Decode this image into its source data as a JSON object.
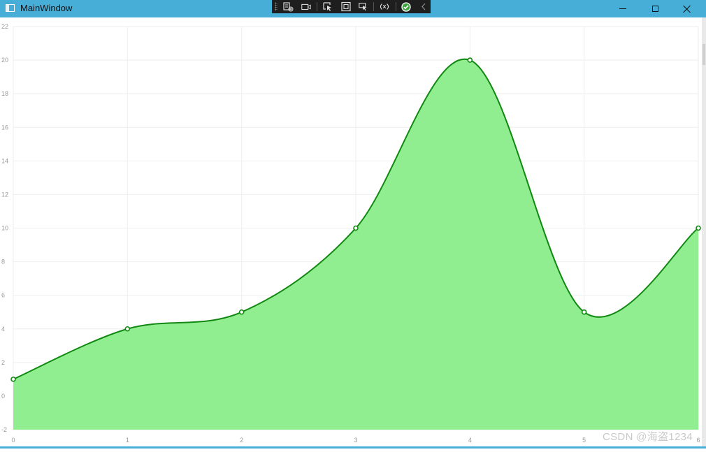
{
  "window": {
    "title": "MainWindow",
    "controls": {
      "minimize": "minimize-icon",
      "maximize": "maximize-icon",
      "close": "close-icon"
    },
    "accent_color": "#47aed8"
  },
  "debug_toolbar": {
    "icons": [
      "visual-tree-icon",
      "record-icon",
      "select-element-icon",
      "display-layout-adorners-icon",
      "track-focus-icon",
      "binding-failures-icon",
      "hot-reload-ok-icon",
      "collapse-toolbar-icon"
    ],
    "background": "#1e1e1e"
  },
  "watermark": {
    "text": "CSDN @海盗1234"
  },
  "chart_data": {
    "type": "area",
    "x": [
      0,
      1,
      2,
      3,
      4,
      5,
      6
    ],
    "values": [
      1,
      4,
      5,
      10,
      20,
      5,
      10
    ],
    "xlim": [
      0,
      6
    ],
    "ylim": [
      -2,
      22
    ],
    "xticks": [
      "0",
      "1",
      "2",
      "3",
      "4",
      "5",
      "6"
    ],
    "yticks": [
      "-2",
      "0",
      "2",
      "4",
      "6",
      "8",
      "10",
      "12",
      "14",
      "16",
      "18",
      "20",
      "22"
    ],
    "title": "",
    "xlabel": "",
    "ylabel": "",
    "grid": true,
    "smooth": true,
    "fill_color": "#90ee90",
    "line_color": "#118811",
    "grid_color": "#eeeeee",
    "tick_color": "#999999"
  }
}
